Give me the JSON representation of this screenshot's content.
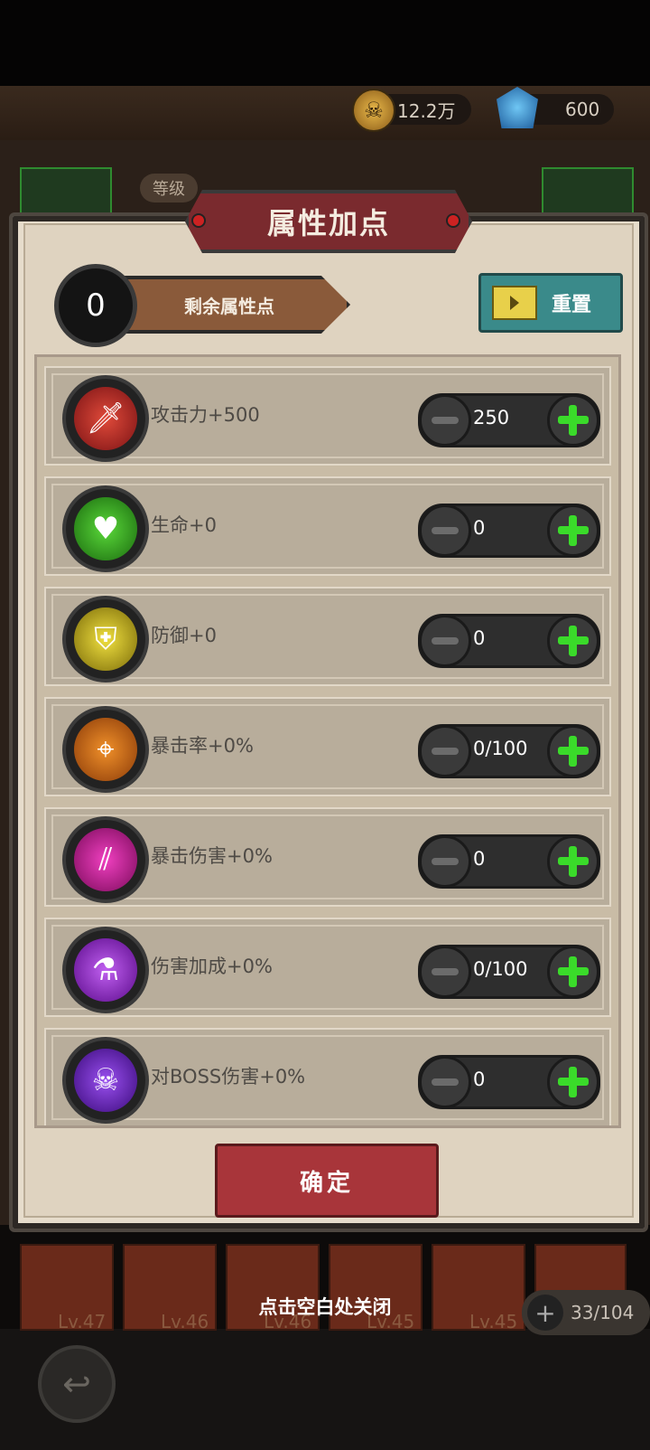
{
  "currency": {
    "coins": "12.2万",
    "gems": "600"
  },
  "background": {
    "level_tab": "等级"
  },
  "dialog": {
    "title": "属性加点",
    "remaining_points_value": "0",
    "remaining_points_label": "剩余属性点",
    "reset_label": "重置",
    "confirm_label": "确定"
  },
  "attributes": [
    {
      "label": "攻击力+500",
      "value": "250",
      "icon": "sword-icon",
      "color": "#c0282a"
    },
    {
      "label": "生命+0",
      "value": "0",
      "icon": "heart-icon",
      "color": "#2a9a1a"
    },
    {
      "label": "防御+0",
      "value": "0",
      "icon": "shield-icon",
      "color": "#c8b818"
    },
    {
      "label": "暴击率+0%",
      "value": "0/100",
      "icon": "crosshair-icon",
      "color": "#d8661a"
    },
    {
      "label": "暴击伤害+0%",
      "value": "0",
      "icon": "claw-icon",
      "color": "#d0209a"
    },
    {
      "label": "伤害加成+0%",
      "value": "0/100",
      "icon": "potion-icon",
      "color": "#a02ad0"
    },
    {
      "label": "对BOSS伤害+0%",
      "value": "0",
      "icon": "demon-skull-icon",
      "color": "#6a2ab8"
    }
  ],
  "inventory": {
    "levels": [
      "Lv.47",
      "Lv.46",
      "Lv.46",
      "Lv.45",
      "Lv.45"
    ],
    "bag_count": "33/104"
  },
  "close_hint": "点击空白处关闭"
}
